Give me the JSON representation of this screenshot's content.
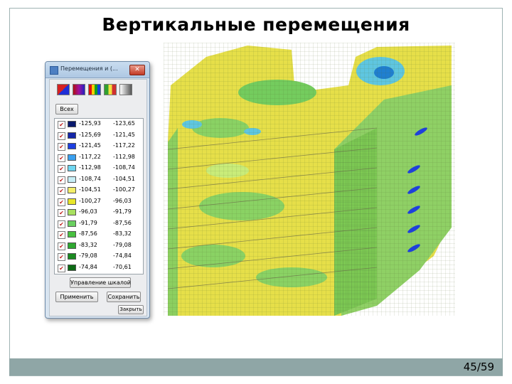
{
  "slide": {
    "title": "Вертикальные перемещения",
    "page": "45/59"
  },
  "dialog": {
    "title": "Перемещения и (...",
    "close_label": "✕",
    "all_button": "Всех",
    "palette_icons": [
      "palette-red-blue-icon",
      "palette-purple-blue-icon",
      "palette-rainbow-icon",
      "palette-green-yellow-red-icon",
      "palette-grayscale-icon"
    ],
    "legend": [
      {
        "from": "-125,93",
        "to": "-123,65",
        "color": "#0a1a6e"
      },
      {
        "from": "-125,69",
        "to": "-121,45",
        "color": "#1426a8"
      },
      {
        "from": "-121,45",
        "to": "-117,22",
        "color": "#1d3fe0"
      },
      {
        "from": "-117,22",
        "to": "-112,98",
        "color": "#3aa0f0"
      },
      {
        "from": "-112,98",
        "to": "-108,74",
        "color": "#6fd6f0"
      },
      {
        "from": "-108,74",
        "to": "-104,51",
        "color": "#c7eef5"
      },
      {
        "from": "-104,51",
        "to": "-100,27",
        "color": "#f4ef6a"
      },
      {
        "from": "-100,27",
        "to": "-96,03",
        "color": "#e8e62a"
      },
      {
        "from": "-96,03",
        "to": "-91,79",
        "color": "#a8e060"
      },
      {
        "from": "-91,79",
        "to": "-87,56",
        "color": "#6ad060"
      },
      {
        "from": "-87,56",
        "to": "-83,32",
        "color": "#48c040"
      },
      {
        "from": "-83,32",
        "to": "-79,08",
        "color": "#2ea830"
      },
      {
        "from": "-79,08",
        "to": "-74,84",
        "color": "#1a8a20"
      },
      {
        "from": "-74,84",
        "to": "-70,61",
        "color": "#0d6a14"
      }
    ],
    "scale_button": "Управление шкалой",
    "apply_button": "Применить",
    "save_button": "Сохранить",
    "close_button": "Закрыть"
  },
  "colors": {
    "bottom_bar": "#8fa6a6",
    "model_yellow": "#e9e24a",
    "model_green": "#7fcf5c",
    "model_cyan": "#5fc6e0"
  }
}
